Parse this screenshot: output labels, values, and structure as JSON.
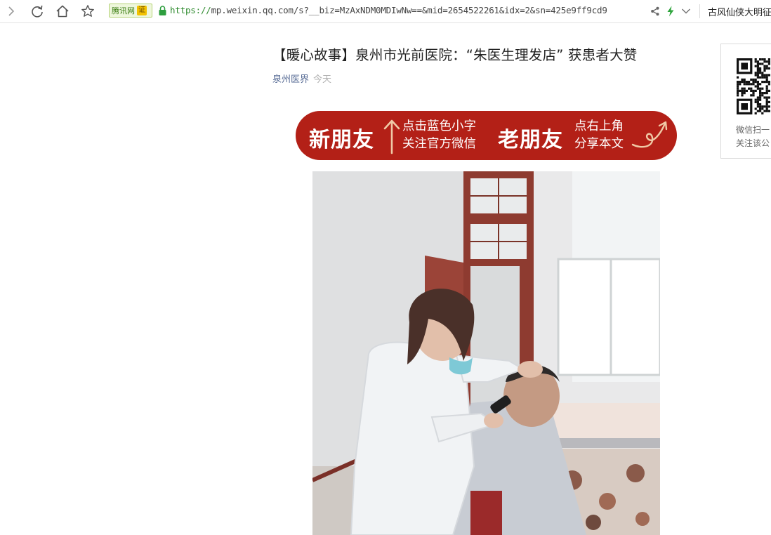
{
  "browser": {
    "url_scheme": "https://",
    "url_rest": "mp.weixin.qq.com/s?__biz=MzAxNDM0MDIwNw==&mid=2654522261&idx=2&sn=425e9ff9cd9",
    "cert_name": "腾讯网",
    "cert_mark": "证",
    "bookmark": "古风仙侠大明征"
  },
  "article": {
    "title": "【暖心故事】泉州市光前医院：“朱医生理发店” 获患者大赞",
    "account_name": "泉州医界",
    "date": "今天"
  },
  "banner": {
    "new_friend": "新朋友",
    "new_line1": "点击蓝色小字",
    "new_line2": "关注官方微信",
    "old_friend": "老朋友",
    "old_line1": "点右上角",
    "old_line2": "分享本文",
    "color": "#b32017"
  },
  "qr": {
    "line1": "微信扫一",
    "line2": "关注该公"
  }
}
